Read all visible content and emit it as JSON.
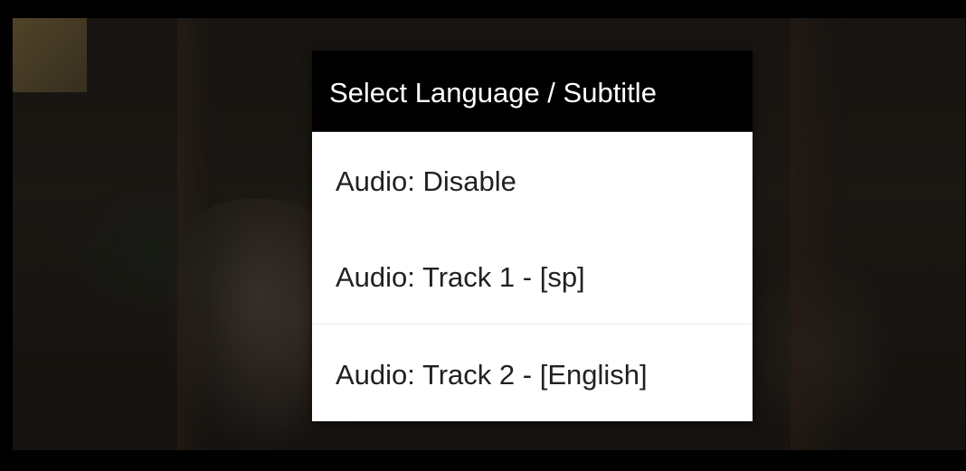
{
  "dialog": {
    "title": "Select Language / Subtitle",
    "options": [
      {
        "label": "Audio: Disable"
      },
      {
        "label": "Audio: Track 1 - [sp]"
      },
      {
        "label": "Audio: Track 2 - [English]"
      }
    ]
  },
  "colors": {
    "header_background": "#000000",
    "header_text": "#ffffff",
    "dialog_background": "#ffffff",
    "option_text": "#212121",
    "screen_background": "#000000"
  }
}
